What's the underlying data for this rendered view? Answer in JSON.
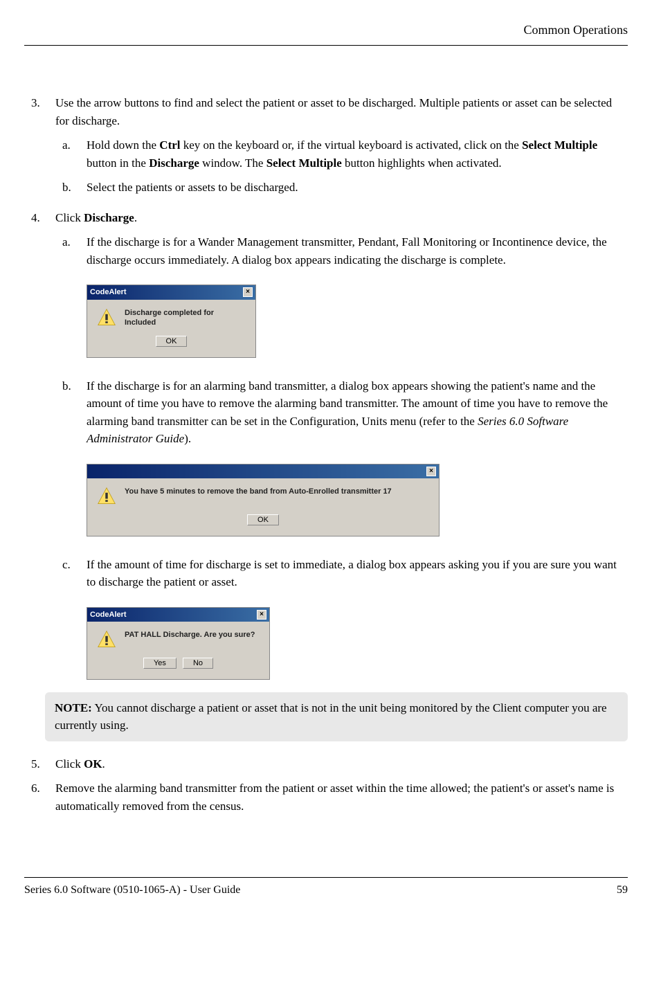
{
  "header": {
    "title": "Common Operations"
  },
  "steps": {
    "s3": {
      "num": "3.",
      "text": "Use the arrow buttons to find and select the patient or asset to be discharged. Multiple patients or asset can be selected for discharge.",
      "a": {
        "num": "a.",
        "prefix": "Hold down the ",
        "bold1": "Ctrl",
        "mid1": " key on the keyboard or, if the virtual keyboard is activated, click on the ",
        "bold2": "Select Multiple",
        "mid2": " button in the ",
        "bold3": "Discharge",
        "mid3": " window. The ",
        "bold4": "Select Multiple",
        "suffix": " button highlights when activated."
      },
      "b": {
        "num": "b.",
        "text": "Select the patients or assets to be discharged."
      }
    },
    "s4": {
      "num": "4.",
      "prefix": "Click ",
      "bold": "Discharge",
      "suffix": ".",
      "a": {
        "num": "a.",
        "text": "If the discharge is for a Wander Management transmitter, Pendant, Fall Monitoring or Incontinence device, the discharge occurs immediately. A dialog box appears indicating the discharge is complete."
      },
      "b": {
        "num": "b.",
        "prefix": "If the discharge is for an alarming band transmitter, a dialog box appears showing the patient's name and the amount of time you have to remove the alarming band transmitter. The amount of time you have to remove the alarming band transmitter can be set in the Configuration, Units menu (refer to the ",
        "italic": "Series 6.0 Software Administrator Guide",
        "suffix": ")."
      },
      "c": {
        "num": "c.",
        "text": "If the amount of time for discharge is set to immediate, a dialog box appears asking you if you are sure you want to discharge the patient or asset."
      }
    },
    "s5": {
      "num": "5.",
      "prefix": "Click ",
      "bold": "OK",
      "suffix": "."
    },
    "s6": {
      "num": "6.",
      "text": "Remove the alarming band transmitter from the patient or asset within the time allowed; the patient's or asset's name is automatically removed from the census."
    }
  },
  "dialogs": {
    "d1": {
      "title": "CodeAlert",
      "text": "Discharge completed for Included",
      "ok": "OK"
    },
    "d2": {
      "text": "You have 5 minutes to remove the band from Auto-Enrolled transmitter 17",
      "ok": "OK"
    },
    "d3": {
      "title": "CodeAlert",
      "text": "PAT HALL Discharge. Are you sure?",
      "yes": "Yes",
      "no": "No"
    }
  },
  "note": {
    "label": "NOTE:",
    "text": " You cannot discharge a patient or asset that is not in the unit being monitored by the Client computer you are currently using."
  },
  "footer": {
    "left": "Series 6.0 Software (0510-1065-A) - User Guide",
    "right": "59"
  }
}
